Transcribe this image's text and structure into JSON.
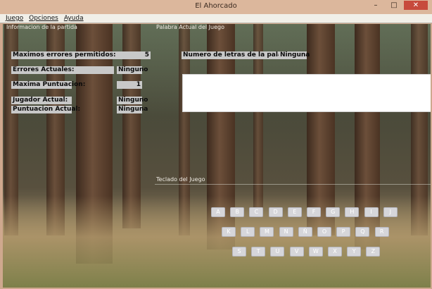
{
  "window": {
    "title": "El Ahorcado",
    "buttons": {
      "minimize": "–",
      "maximize": "□",
      "close": "✕"
    }
  },
  "menu": [
    {
      "label": "Juego"
    },
    {
      "label": "Opciones"
    },
    {
      "label": "Ayuda"
    }
  ],
  "sections": {
    "info_title": "Informacion de la partida",
    "word_title": "Palabra Actual del Juego",
    "keyboard_title": "Teclado del Juego"
  },
  "info": [
    {
      "label": "Maximos errores permitidos:",
      "value": "5"
    },
    {
      "label": "Errores Actuales:",
      "value": "Ninguno"
    },
    {
      "label": "Maxima Puntuacion:",
      "value": "1"
    },
    {
      "label": "Jugador Actual:",
      "value": "Ninguno"
    },
    {
      "label": "Puntuacion Actual:",
      "value": "Ninguna"
    }
  ],
  "letters_count": {
    "label": "Numero de letras de la palabra:",
    "value": "Ninguna"
  },
  "current_word": "",
  "keyboard": {
    "row1": [
      "A",
      "B",
      "C",
      "D",
      "E",
      "F",
      "G",
      "H",
      "I",
      "J"
    ],
    "row2": [
      "K",
      "L",
      "M",
      "N",
      "Ñ",
      "O",
      "P",
      "Q",
      "R"
    ],
    "row3": [
      "S",
      "T",
      "U",
      "V",
      "W",
      "X",
      "Y",
      "Z"
    ]
  }
}
